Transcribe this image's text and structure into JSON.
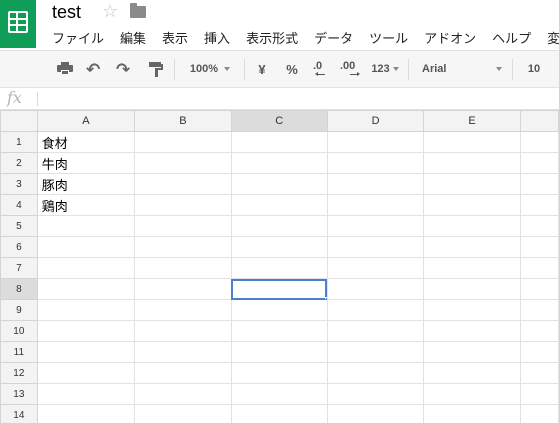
{
  "app": {
    "title": "test"
  },
  "menu": {
    "items": [
      "ファイル",
      "編集",
      "表示",
      "挿入",
      "表示形式",
      "データ",
      "ツール",
      "アドオン",
      "ヘルプ",
      "変"
    ]
  },
  "toolbar": {
    "zoom": "100%",
    "currency": "¥",
    "percent": "%",
    "decrease_decimal": ".0",
    "increase_decimal": ".00",
    "more_formats": "123",
    "font": "Arial",
    "font_size": "10"
  },
  "formula_bar": {
    "value": ""
  },
  "sheet": {
    "columns": [
      "A",
      "B",
      "C",
      "D",
      "E"
    ],
    "rows": [
      {
        "n": "1",
        "cells": [
          "食材",
          "",
          "",
          "",
          ""
        ]
      },
      {
        "n": "2",
        "cells": [
          "牛肉",
          "",
          "",
          "",
          ""
        ]
      },
      {
        "n": "3",
        "cells": [
          "豚肉",
          "",
          "",
          "",
          ""
        ]
      },
      {
        "n": "4",
        "cells": [
          "鶏肉",
          "",
          "",
          "",
          ""
        ]
      },
      {
        "n": "5",
        "cells": [
          "",
          "",
          "",
          "",
          ""
        ]
      },
      {
        "n": "6",
        "cells": [
          "",
          "",
          "",
          "",
          ""
        ]
      },
      {
        "n": "7",
        "cells": [
          "",
          "",
          "",
          "",
          ""
        ]
      },
      {
        "n": "8",
        "cells": [
          "",
          "",
          "",
          "",
          ""
        ]
      },
      {
        "n": "9",
        "cells": [
          "",
          "",
          "",
          "",
          ""
        ]
      },
      {
        "n": "10",
        "cells": [
          "",
          "",
          "",
          "",
          ""
        ]
      },
      {
        "n": "11",
        "cells": [
          "",
          "",
          "",
          "",
          ""
        ]
      },
      {
        "n": "12",
        "cells": [
          "",
          "",
          "",
          "",
          ""
        ]
      },
      {
        "n": "13",
        "cells": [
          "",
          "",
          "",
          "",
          ""
        ]
      },
      {
        "n": "14",
        "cells": [
          "",
          "",
          "",
          "",
          ""
        ]
      }
    ],
    "active_cell": "C8",
    "selection_color": "#4a7fd4"
  },
  "colors": {
    "brand": "#0f9d58"
  },
  "icons": [
    "sheets-logo-icon",
    "star-icon",
    "folder-icon",
    "print-icon",
    "undo-icon",
    "redo-icon",
    "paint-format-icon",
    "fx-icon"
  ]
}
